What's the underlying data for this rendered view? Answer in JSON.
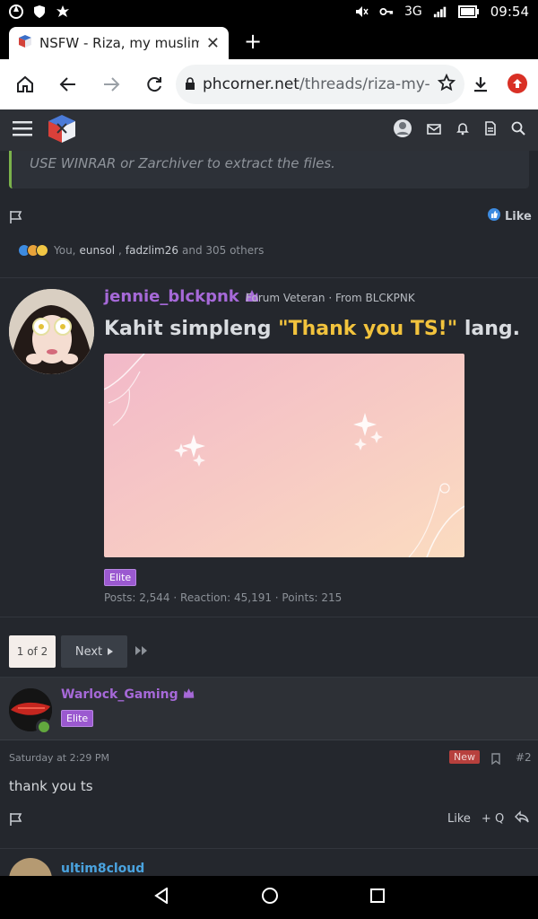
{
  "status": {
    "time": "09:54",
    "network": "3G",
    "battery": "battery-full"
  },
  "tab": {
    "title": "NSFW - Riza, my muslim g",
    "close_icon": "close-icon",
    "new_tab": "+"
  },
  "toolbar": {
    "url_host": "phcorner.net",
    "url_path": "/threads/riza-my-r"
  },
  "quote": {
    "text": "USE WINRAR or Zarchiver to extract the files."
  },
  "post1": {
    "like_label": "Like",
    "reactions": {
      "you": "You,",
      "user1": "eunsol",
      "sep": ",",
      "user2": "fadzlim26",
      "tail": "and 305 others"
    }
  },
  "post2": {
    "username": "jennie_blckpnk",
    "user_title": "Forum Veteran · From BLCKPNK",
    "message_pre": "Kahit simpleng ",
    "message_quote": "\"Thank you TS!\"",
    "message_post": " lang.",
    "badge": "Elite",
    "stats": "Posts: 2,544 · Reaction: 45,191 · Points: 215"
  },
  "pager": {
    "current": "1 of 2",
    "next": "Next"
  },
  "post3": {
    "username": "Warlock_Gaming",
    "badge": "Elite",
    "date": "Saturday at 2:29 PM",
    "new_badge": "New",
    "post_number": "#2",
    "body": "thank you ts",
    "like": "Like",
    "quote": "+ Q"
  },
  "post4": {
    "username": "ultim8cloud"
  },
  "colors": {
    "accent_purple": "#a669d8",
    "quote_border": "#7bb24b",
    "highlight_yellow": "#f2c33d",
    "link_blue": "#4aa3df"
  }
}
